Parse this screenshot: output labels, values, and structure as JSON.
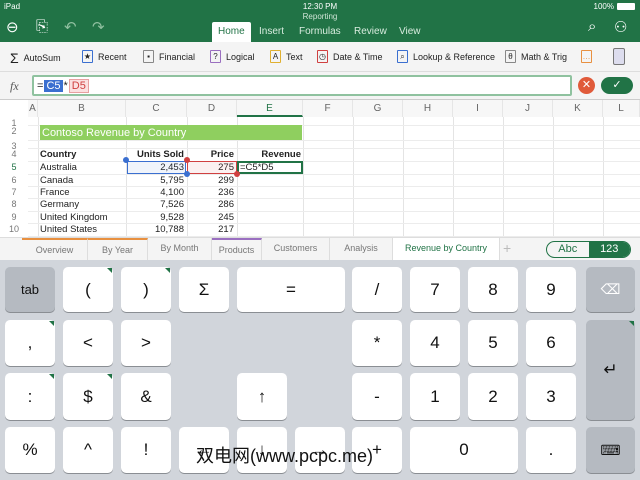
{
  "status": {
    "device": "iPad",
    "time": "12:30 PM",
    "battery": "100%"
  },
  "app": {
    "doc_title": "Reporting"
  },
  "tabs": [
    "Home",
    "Insert",
    "Formulas",
    "Review",
    "View"
  ],
  "ribbon": [
    {
      "label": "AutoSum",
      "icon": "Σ"
    },
    {
      "label": "Recent",
      "icon": "★"
    },
    {
      "label": "Financial",
      "icon": "▪"
    },
    {
      "label": "Logical",
      "icon": "?"
    },
    {
      "label": "Text",
      "icon": "A"
    },
    {
      "label": "Date & Time",
      "icon": "◷"
    },
    {
      "label": "Lookup & Reference",
      "icon": "⌕"
    },
    {
      "label": "Math & Trig",
      "icon": "θ"
    },
    {
      "label": "",
      "icon": "…"
    }
  ],
  "formula": {
    "fx": "fx",
    "eq": "=",
    "ref1": "C5",
    "op": "*",
    "ref2": "D5"
  },
  "columns": [
    "A",
    "B",
    "C",
    "D",
    "E",
    "F",
    "G",
    "H",
    "I",
    "J",
    "K",
    "L"
  ],
  "rows": [
    "1",
    "2",
    "3",
    "4",
    "5",
    "6",
    "7",
    "8",
    "9",
    "10"
  ],
  "sheet": {
    "title": "Contoso Revenue by Country",
    "headers": [
      "Country",
      "Units Sold",
      "Price",
      "Revenue"
    ],
    "data": [
      [
        "Australia",
        "2,453",
        "275",
        "=C5*D5"
      ],
      [
        "Canada",
        "5,795",
        "299",
        ""
      ],
      [
        "France",
        "4,100",
        "236",
        ""
      ],
      [
        "Germany",
        "7,526",
        "286",
        ""
      ],
      [
        "United Kingdom",
        "9,528",
        "245",
        ""
      ],
      [
        "United States",
        "10,788",
        "217",
        ""
      ]
    ]
  },
  "sheet_tabs": [
    "Overview",
    "By Year",
    "By Month",
    "Products",
    "Customers",
    "Analysis",
    "Revenue by Country"
  ],
  "add_sheet": "+",
  "kb_toggle": [
    "Abc",
    "123"
  ],
  "keys": {
    "r1": [
      "tab",
      "(",
      ")",
      "Σ",
      "=",
      "/",
      "7",
      "8",
      "9"
    ],
    "r2": [
      ",",
      "<",
      ">",
      "*",
      "4",
      "5",
      "6"
    ],
    "r3": [
      ":",
      "$",
      "&",
      "↑",
      "-",
      "1",
      "2",
      "3"
    ],
    "r4": [
      "%",
      "^",
      "!",
      "←",
      "↓",
      "→",
      "+",
      "0",
      "."
    ]
  },
  "watermark": "双电网(www.pcpc.me)"
}
